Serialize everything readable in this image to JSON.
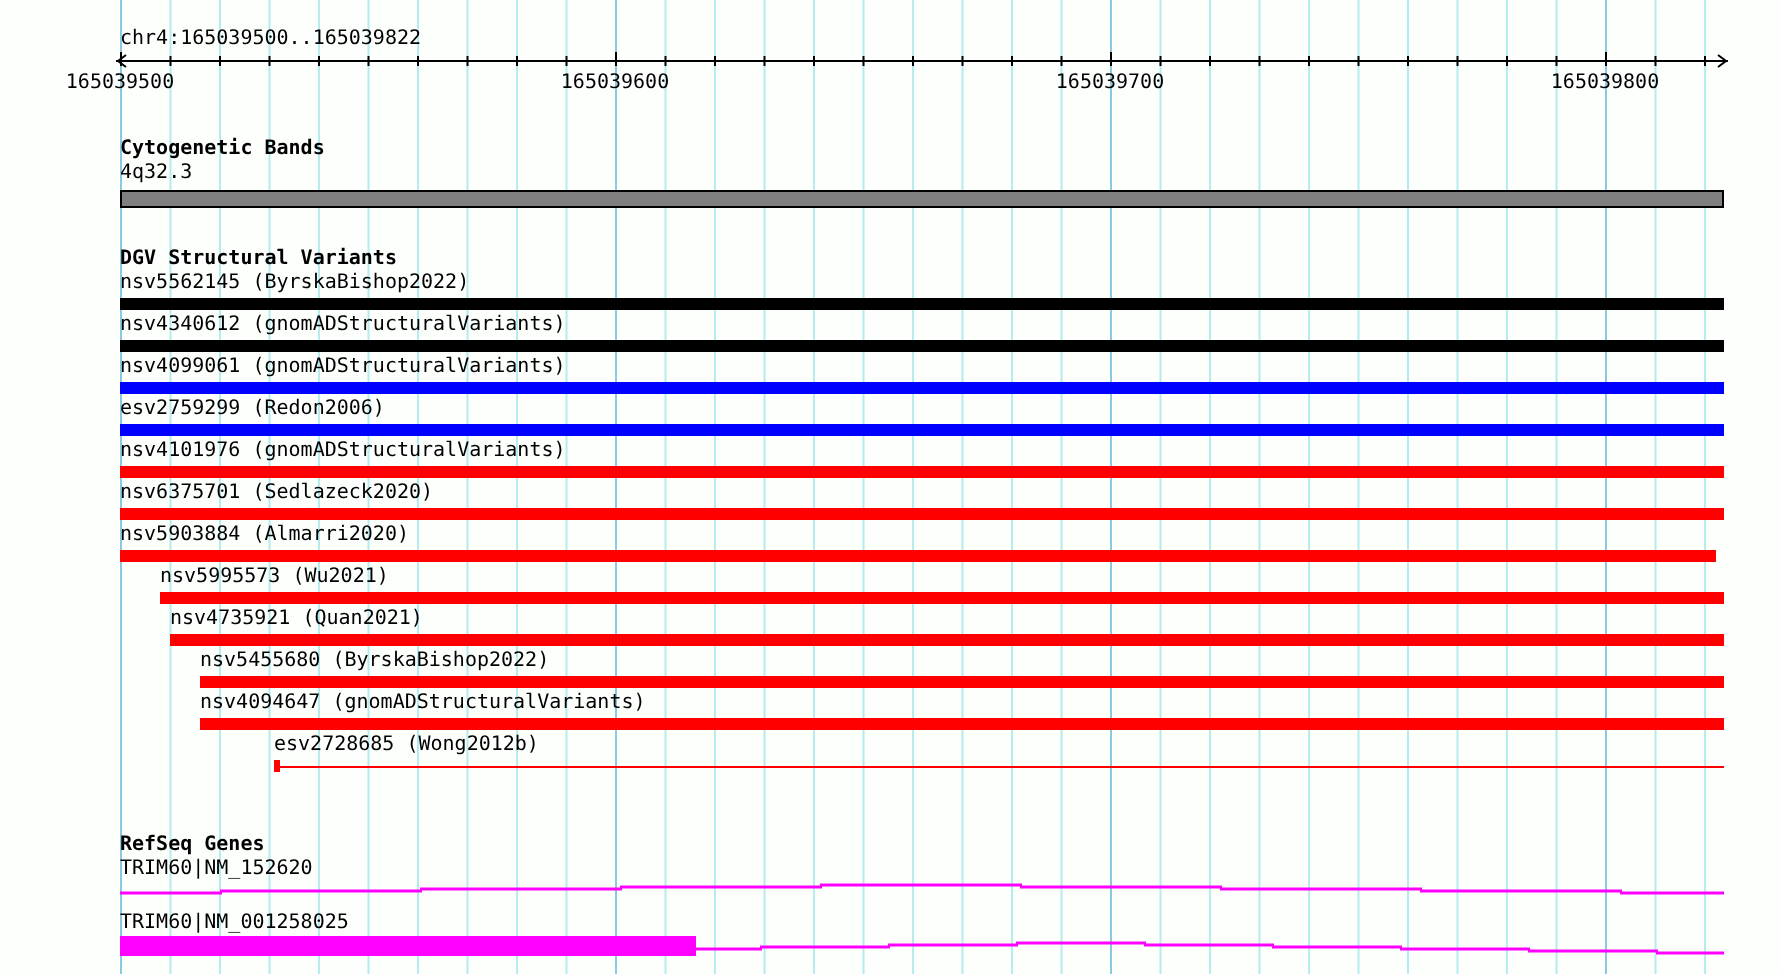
{
  "locus": "chr4:165039500..165039822",
  "ruler": {
    "ticks": [
      "165039500",
      "165039600",
      "165039700",
      "165039800"
    ]
  },
  "tracks": [
    {
      "kind": "cytoband",
      "title": "Cytogenetic Bands",
      "features": [
        {
          "label": "4q32.3"
        }
      ]
    },
    {
      "kind": "variants",
      "title": "DGV Structural Variants",
      "features": [
        {
          "label": "nsv5562145 (ByrskaBishop2022)",
          "color": "#000000",
          "kind": "thick"
        },
        {
          "label": "nsv4340612 (gnomADStructuralVariants)",
          "color": "#000000",
          "kind": "thick"
        },
        {
          "label": "nsv4099061 (gnomADStructuralVariants)",
          "color": "#0000ff",
          "kind": "thick"
        },
        {
          "label": "esv2759299 (Redon2006)",
          "color": "#0000ff",
          "kind": "thick"
        },
        {
          "label": "nsv4101976 (gnomADStructuralVariants)",
          "color": "#ff0000",
          "kind": "thick"
        },
        {
          "label": "nsv6375701 (Sedlazeck2020)",
          "color": "#ff0000",
          "kind": "thick"
        },
        {
          "label": "nsv5903884 (Almarri2020)",
          "color": "#ff0000",
          "kind": "thick"
        },
        {
          "label": "nsv5995573 (Wu2021)",
          "color": "#ff0000",
          "kind": "thick"
        },
        {
          "label": "nsv4735921 (Quan2021)",
          "color": "#ff0000",
          "kind": "thick"
        },
        {
          "label": "nsv5455680 (ByrskaBishop2022)",
          "color": "#ff0000",
          "kind": "thick"
        },
        {
          "label": "nsv4094647 (gnomADStructuralVariants)",
          "color": "#ff0000",
          "kind": "thick"
        },
        {
          "label": "esv2728685 (Wong2012b)",
          "color": "#ff0000",
          "kind": "thin"
        }
      ]
    },
    {
      "kind": "genes",
      "title": "RefSeq Genes",
      "features": [
        {
          "label": "TRIM60|NM_152620"
        },
        {
          "label": "TRIM60|NM_001258025"
        }
      ]
    }
  ]
}
